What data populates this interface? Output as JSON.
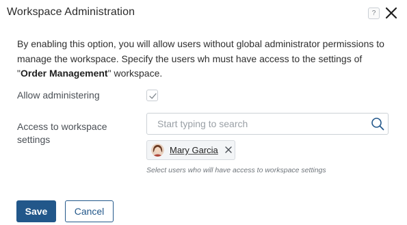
{
  "dialog": {
    "title": "Workspace Administration",
    "help_label": "?",
    "close_icon": "close-icon"
  },
  "description": {
    "line1": "By enabling this option, you will allow users without global administrator permissions to manage the workspace. Specify the users wh must have access to the settings of ",
    "workspace_name": "Order Management",
    "line2": " workspace."
  },
  "allow_administering": {
    "label": "Allow administering",
    "checked": true
  },
  "access": {
    "label": "Access to workspace settings",
    "search_placeholder": "Start typing to search",
    "selected_users": [
      {
        "name": "Mary Garcia"
      }
    ],
    "hint": "Select users who will have access to workspace settings"
  },
  "buttons": {
    "save": "Save",
    "cancel": "Cancel"
  },
  "colors": {
    "primary": "#22578a",
    "border": "#ccd1d6"
  }
}
